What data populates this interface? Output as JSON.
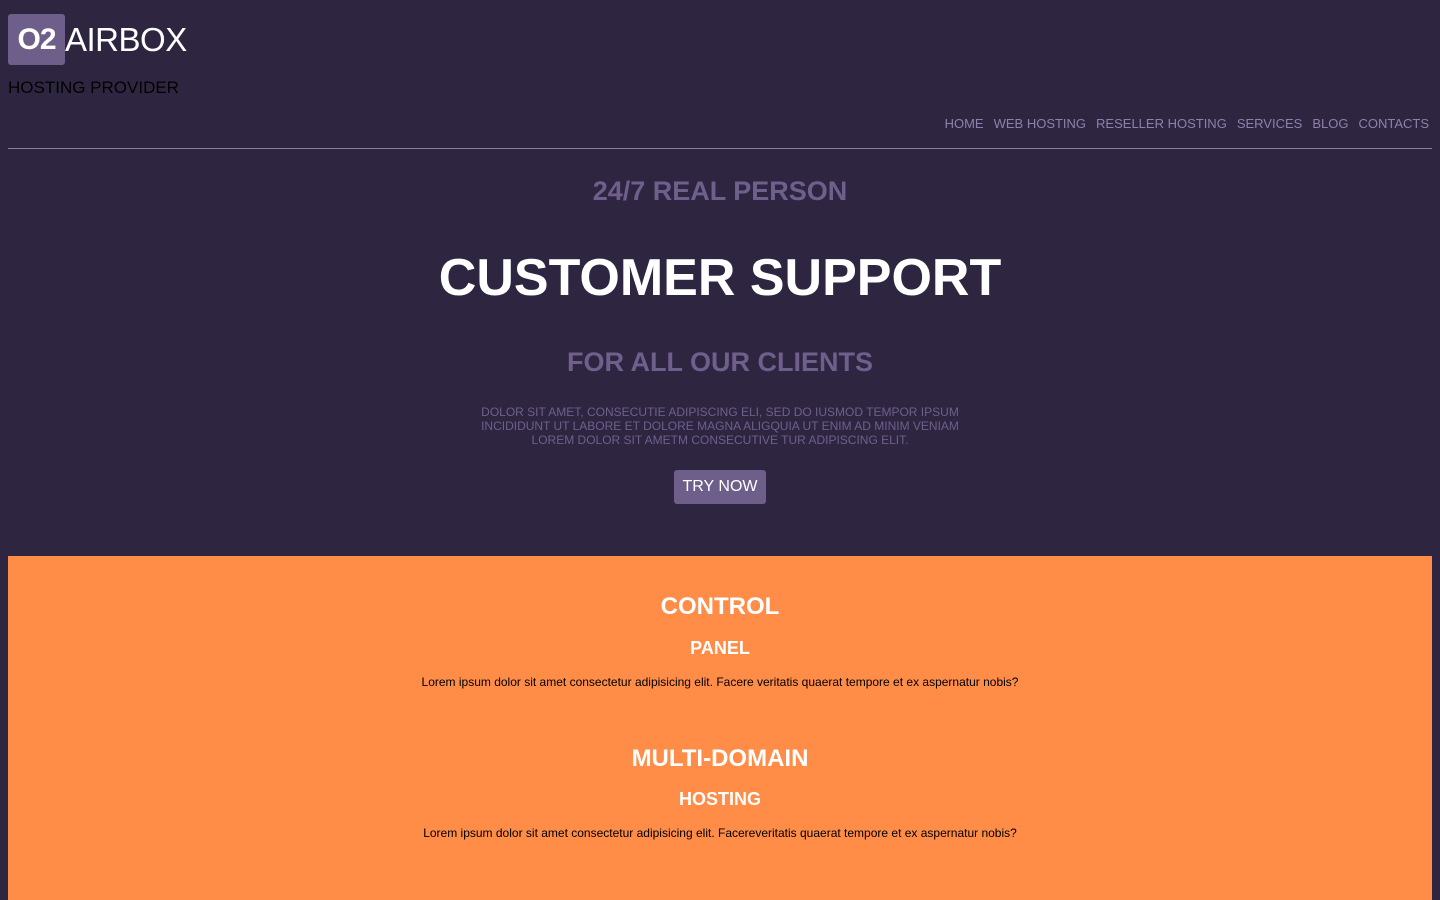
{
  "header": {
    "logo_badge": "O2",
    "logo_text": "AIRBOX",
    "tagline": "HOSTING PROVIDER",
    "nav": [
      "HOME",
      "WEB HOSTING",
      "RESELLER HOSTING",
      "SERVICES",
      "BLOG",
      "CONTACTS"
    ]
  },
  "hero": {
    "kicker": "24/7 REAL PERSON",
    "title": "CUSTOMER SUPPORT",
    "subtitle": "FOR ALL OUR CLIENTS",
    "body": "DOLOR SIT AMET, CONSECUTIE ADIPISCING ELI, SED DO IUSMOD TEMPOR IPSUM INCIDIDUNT UT LABORE ET DOLORE MAGNA ALIGQUIA UT ENIM AD MINIM VENIAM LOREM DOLOR SIT AMETM CONSECUTIVE TUR ADIPISCING ELIT.",
    "cta": "TRY NOW"
  },
  "features": [
    {
      "title": "CONTROL",
      "subtitle": "PANEL",
      "text": "Lorem ipsum dolor sit amet consectetur adipisicing elit. Facere veritatis quaerat tempore et ex aspernatur nobis?"
    },
    {
      "title": "MULTI-DOMAIN",
      "subtitle": "HOSTING",
      "text": "Lorem ipsum dolor sit amet consectetur adipisicing elit. Facereveritatis quaerat tempore et ex aspernatur nobis?"
    }
  ],
  "colors": {
    "background": "#2e2640",
    "accent": "#6e5f8a",
    "muted_text": "#6f5f8c",
    "nav_text": "#8d80aa",
    "features_bg": "#ff8c47"
  }
}
